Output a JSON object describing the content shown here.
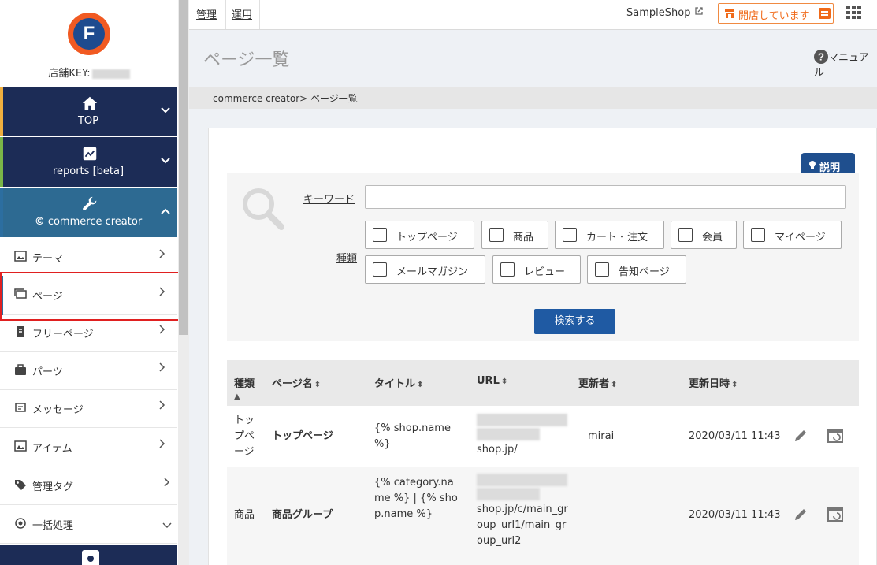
{
  "sidebar": {
    "store_key_label": "店舗KEY:",
    "logo_letter": "F",
    "main_nav": [
      {
        "label": "TOP",
        "icon": "home-icon",
        "expanded": false,
        "accent": "#f0b03f"
      },
      {
        "label": "reports [beta]",
        "icon": "chart-icon",
        "expanded": false,
        "accent": "#7ab648"
      },
      {
        "label": "commerce creator",
        "icon": "wrench-icon",
        "expanded": true,
        "accent": "#2c6ea0"
      }
    ],
    "logo_prefix_cc": "©",
    "chevron_down": "⌄",
    "chevron_up": "⌃",
    "chevron_right": "›",
    "sub_nav": [
      {
        "label": "テーマ",
        "icon": "theme-icon"
      },
      {
        "label": "ページ",
        "icon": "page-icon",
        "active": true
      },
      {
        "label": "フリーページ",
        "icon": "free-page-icon"
      },
      {
        "label": "パーツ",
        "icon": "parts-icon"
      },
      {
        "label": "メッセージ",
        "icon": "message-icon"
      },
      {
        "label": "アイテム",
        "icon": "item-icon"
      },
      {
        "label": "管理タグ",
        "icon": "tag-icon"
      },
      {
        "label": "一括処理",
        "icon": "batch-icon",
        "expandable": true
      }
    ]
  },
  "topbar": {
    "links": [
      "管理",
      "運用"
    ],
    "shop_link": "SampleShop",
    "open_status": "開店しています"
  },
  "main": {
    "page_title": "ページ一覧",
    "manual_label": "マニュアル",
    "breadcrumb": "commerce creator> ページ一覧",
    "explain_label": "説明",
    "search": {
      "keyword_label": "キーワード",
      "keyword_value": "",
      "type_label": "種類",
      "types_row1": [
        "トップページ",
        "商品",
        "カート・注文",
        "会員",
        "マイページ"
      ],
      "types_row2": [
        "メールマガジン",
        "レビュー",
        "告知ページ"
      ],
      "search_button": "検索する"
    },
    "table": {
      "headers": [
        "種類",
        "ページ名",
        "タイトル",
        "URL",
        "更新者",
        "更新日時"
      ],
      "sort_icon": "⬍",
      "sort_asc": "▲",
      "rows": [
        {
          "type": "トップページ",
          "name": "トップページ",
          "title": "{% shop.name %}",
          "url_suffix": "shop.jp/",
          "updater": "mirai",
          "updated": "2020/03/11 11:43"
        },
        {
          "type": "商品",
          "name": "商品グループ",
          "title": "{% category.name %} | {% shop.name %}",
          "url_suffix": "shop.jp/c/main_group_url1/main_group_url2",
          "updater": "",
          "updated": "2020/03/11 11:43"
        }
      ]
    }
  },
  "colors": {
    "sidebar_dark": "#1c2c56",
    "sidebar_active": "#2d6a92",
    "accent_orange": "#f06a1a",
    "search_button": "#1f5aa3",
    "highlight_red": "#e02020"
  }
}
